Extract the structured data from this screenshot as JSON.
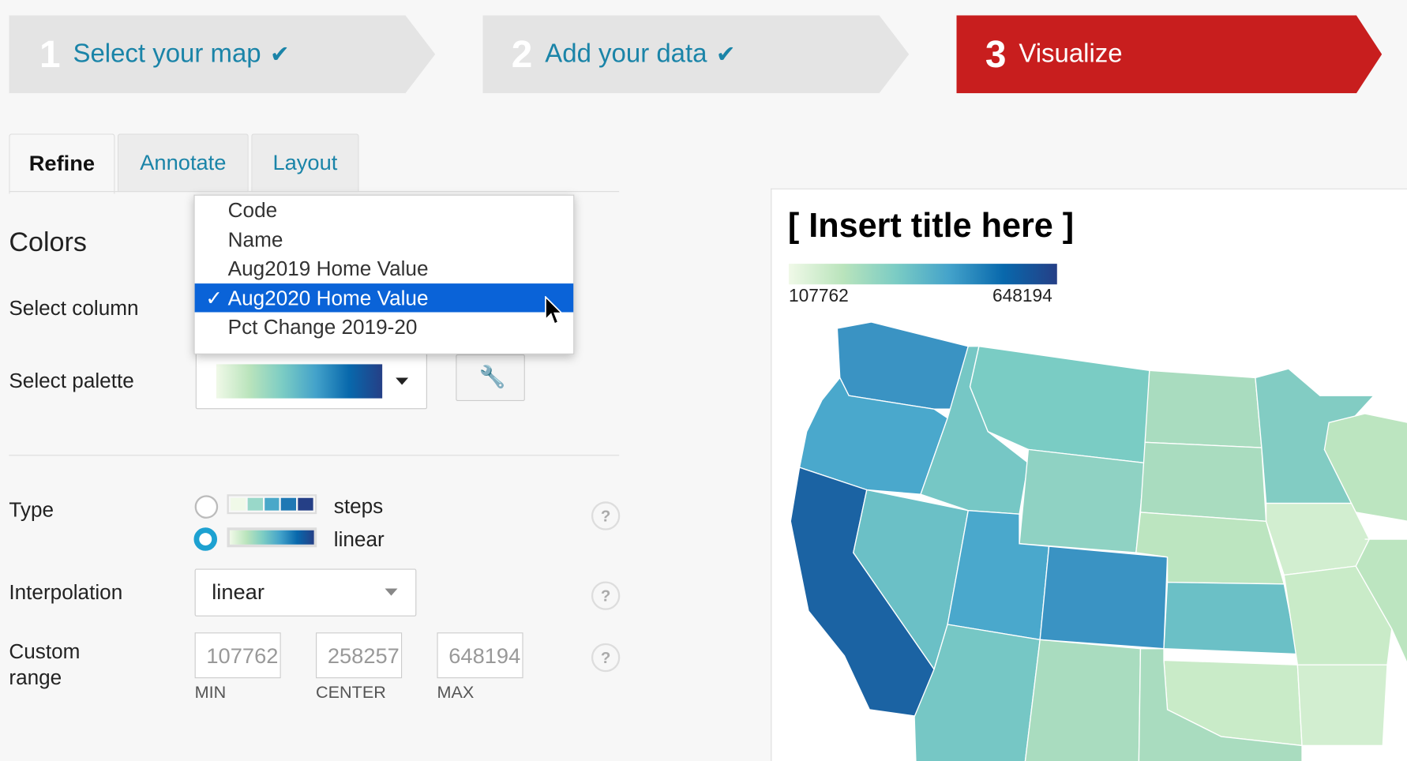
{
  "steps": [
    {
      "num": "1",
      "label": "Select your map",
      "done": true
    },
    {
      "num": "2",
      "label": "Add your data",
      "done": true
    },
    {
      "num": "3",
      "label": "Visualize",
      "done": false
    }
  ],
  "tabs": [
    "Refine",
    "Annotate",
    "Layout"
  ],
  "colors_heading": "Colors",
  "select_column_label": "Select column",
  "column_options": [
    "Code",
    "Name",
    "Aug2019 Home Value",
    "Aug2020 Home Value",
    "Pct Change 2019-20"
  ],
  "selected_column": "Aug2020 Home Value",
  "select_palette_label": "Select palette",
  "type_label": "Type",
  "type_options": [
    "steps",
    "linear"
  ],
  "type_selected": "linear",
  "interpolation_label": "Interpolation",
  "interpolation_value": "linear",
  "custom_range_label": "Custom range",
  "range": {
    "min": "107762",
    "center": "258257",
    "max": "648194",
    "min_label": "MIN",
    "center_label": "CENTER",
    "max_label": "MAX"
  },
  "map": {
    "title": "[ Insert title here ]",
    "legend_min": "107762",
    "legend_max": "648194"
  },
  "palette_colors": [
    "#f0f9e8",
    "#bae4bc",
    "#7bccc4",
    "#43a2ca",
    "#0868ac",
    "#253f86"
  ]
}
